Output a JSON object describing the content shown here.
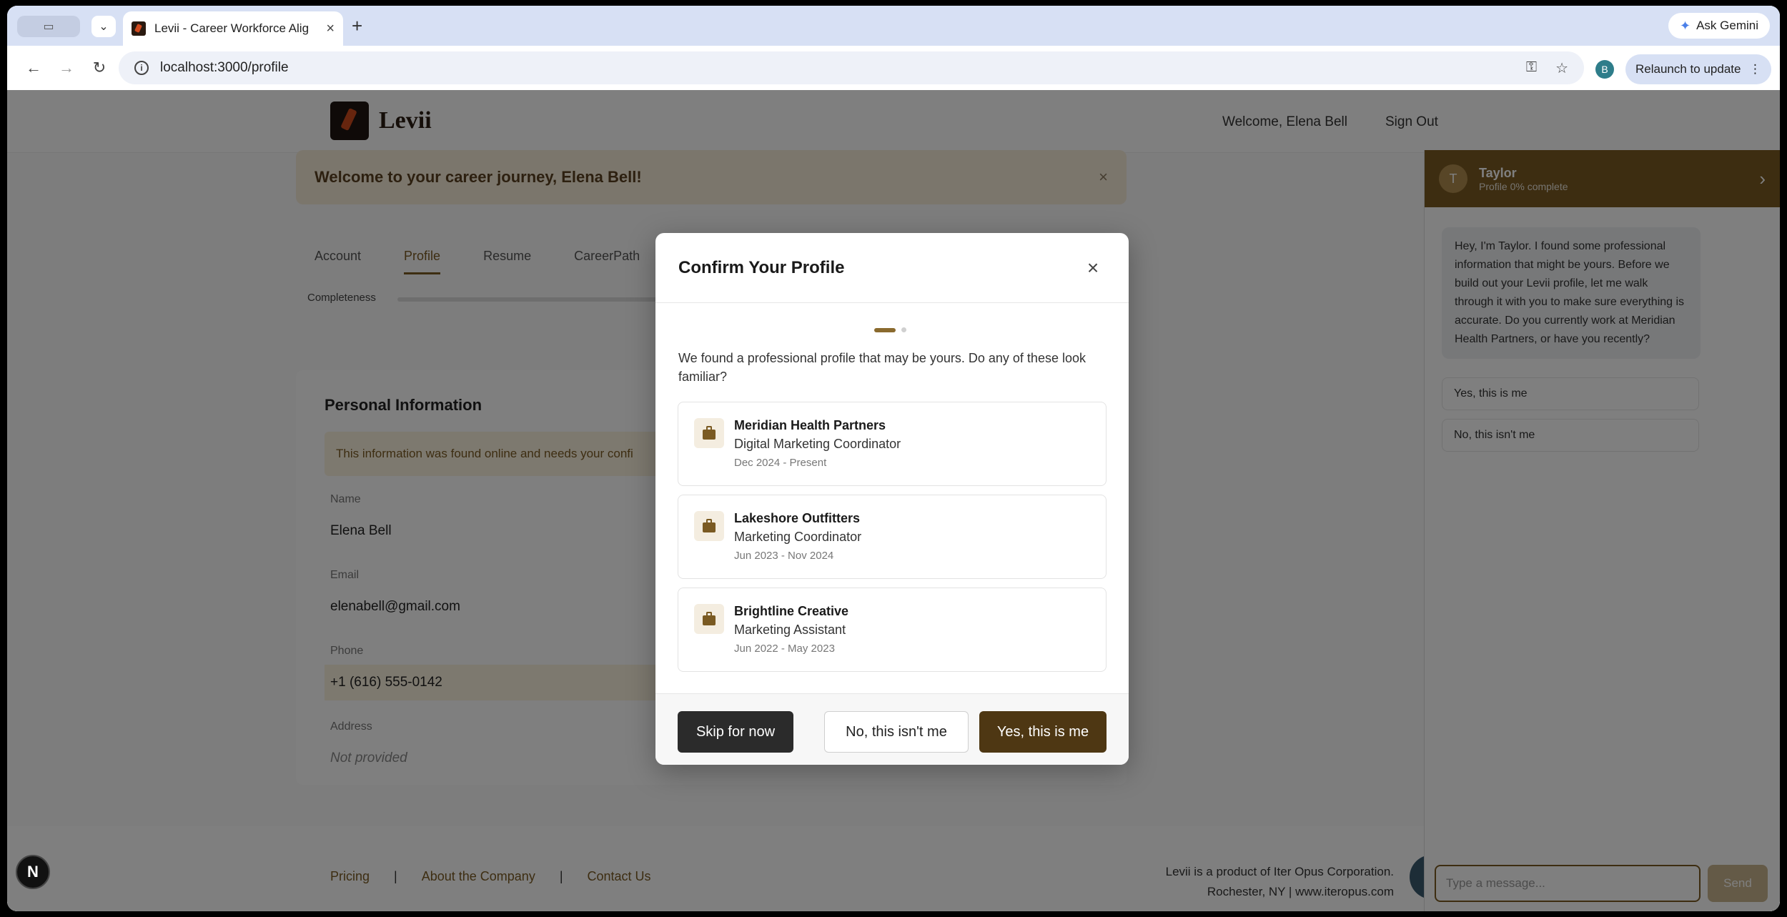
{
  "browser": {
    "tab_title": "Levii - Career Workforce Alig",
    "url": "localhost:3000/profile",
    "ask_gemini": "Ask Gemini",
    "relaunch": "Relaunch to update",
    "profile_initial": "B"
  },
  "site": {
    "logo_text": "Levii",
    "welcome": "Welcome, Elena Bell",
    "sign_out": "Sign Out",
    "banner": "Welcome to your career journey, Elena Bell!",
    "tabs": [
      "Account",
      "Profile",
      "Resume",
      "CareerPath"
    ],
    "completeness_label": "Completeness",
    "section_title": "Personal Information",
    "notice": "This information was found online and needs your confi",
    "fields": {
      "name_label": "Name",
      "name_value": "Elena Bell",
      "email_label": "Email",
      "email_value": "elenabell@gmail.com",
      "phone_label": "Phone",
      "phone_value": "+1 (616) 555-0142",
      "address_label": "Address",
      "address_value": "Not provided"
    },
    "footer": {
      "links": [
        "Pricing",
        "About the Company",
        "Contact Us"
      ],
      "right_line1": "Levii is a product of Iter Opus Corporation.",
      "right_line2": "Rochester, NY | www.iteropus.com"
    }
  },
  "chat": {
    "avatar_initial": "T",
    "name": "Taylor",
    "status": "Profile 0% complete",
    "message": "Hey, I'm Taylor. I found some professional information that might be yours. Before we build out your Levii profile, let me walk through it with you to make sure everything is accurate. Do you currently work at Meridian Health Partners, or have you recently?",
    "option_yes": "Yes, this is me",
    "option_no": "No, this isn't me",
    "input_placeholder": "Type a message...",
    "send": "Send"
  },
  "modal": {
    "title": "Confirm Your Profile",
    "description": "We found a professional profile that may be yours. Do any of these look familiar?",
    "jobs": [
      {
        "company": "Meridian Health Partners",
        "title": "Digital Marketing Coordinator",
        "dates": "Dec 2024 - Present"
      },
      {
        "company": "Lakeshore Outfitters",
        "title": "Marketing Coordinator",
        "dates": "Jun 2023 - Nov 2024"
      },
      {
        "company": "Brightline Creative",
        "title": "Marketing Assistant",
        "dates": "Jun 2022 - May 2023"
      }
    ],
    "skip": "Skip for now",
    "no": "No, this isn't me",
    "yes": "Yes, this is me"
  },
  "next_badge": "N"
}
